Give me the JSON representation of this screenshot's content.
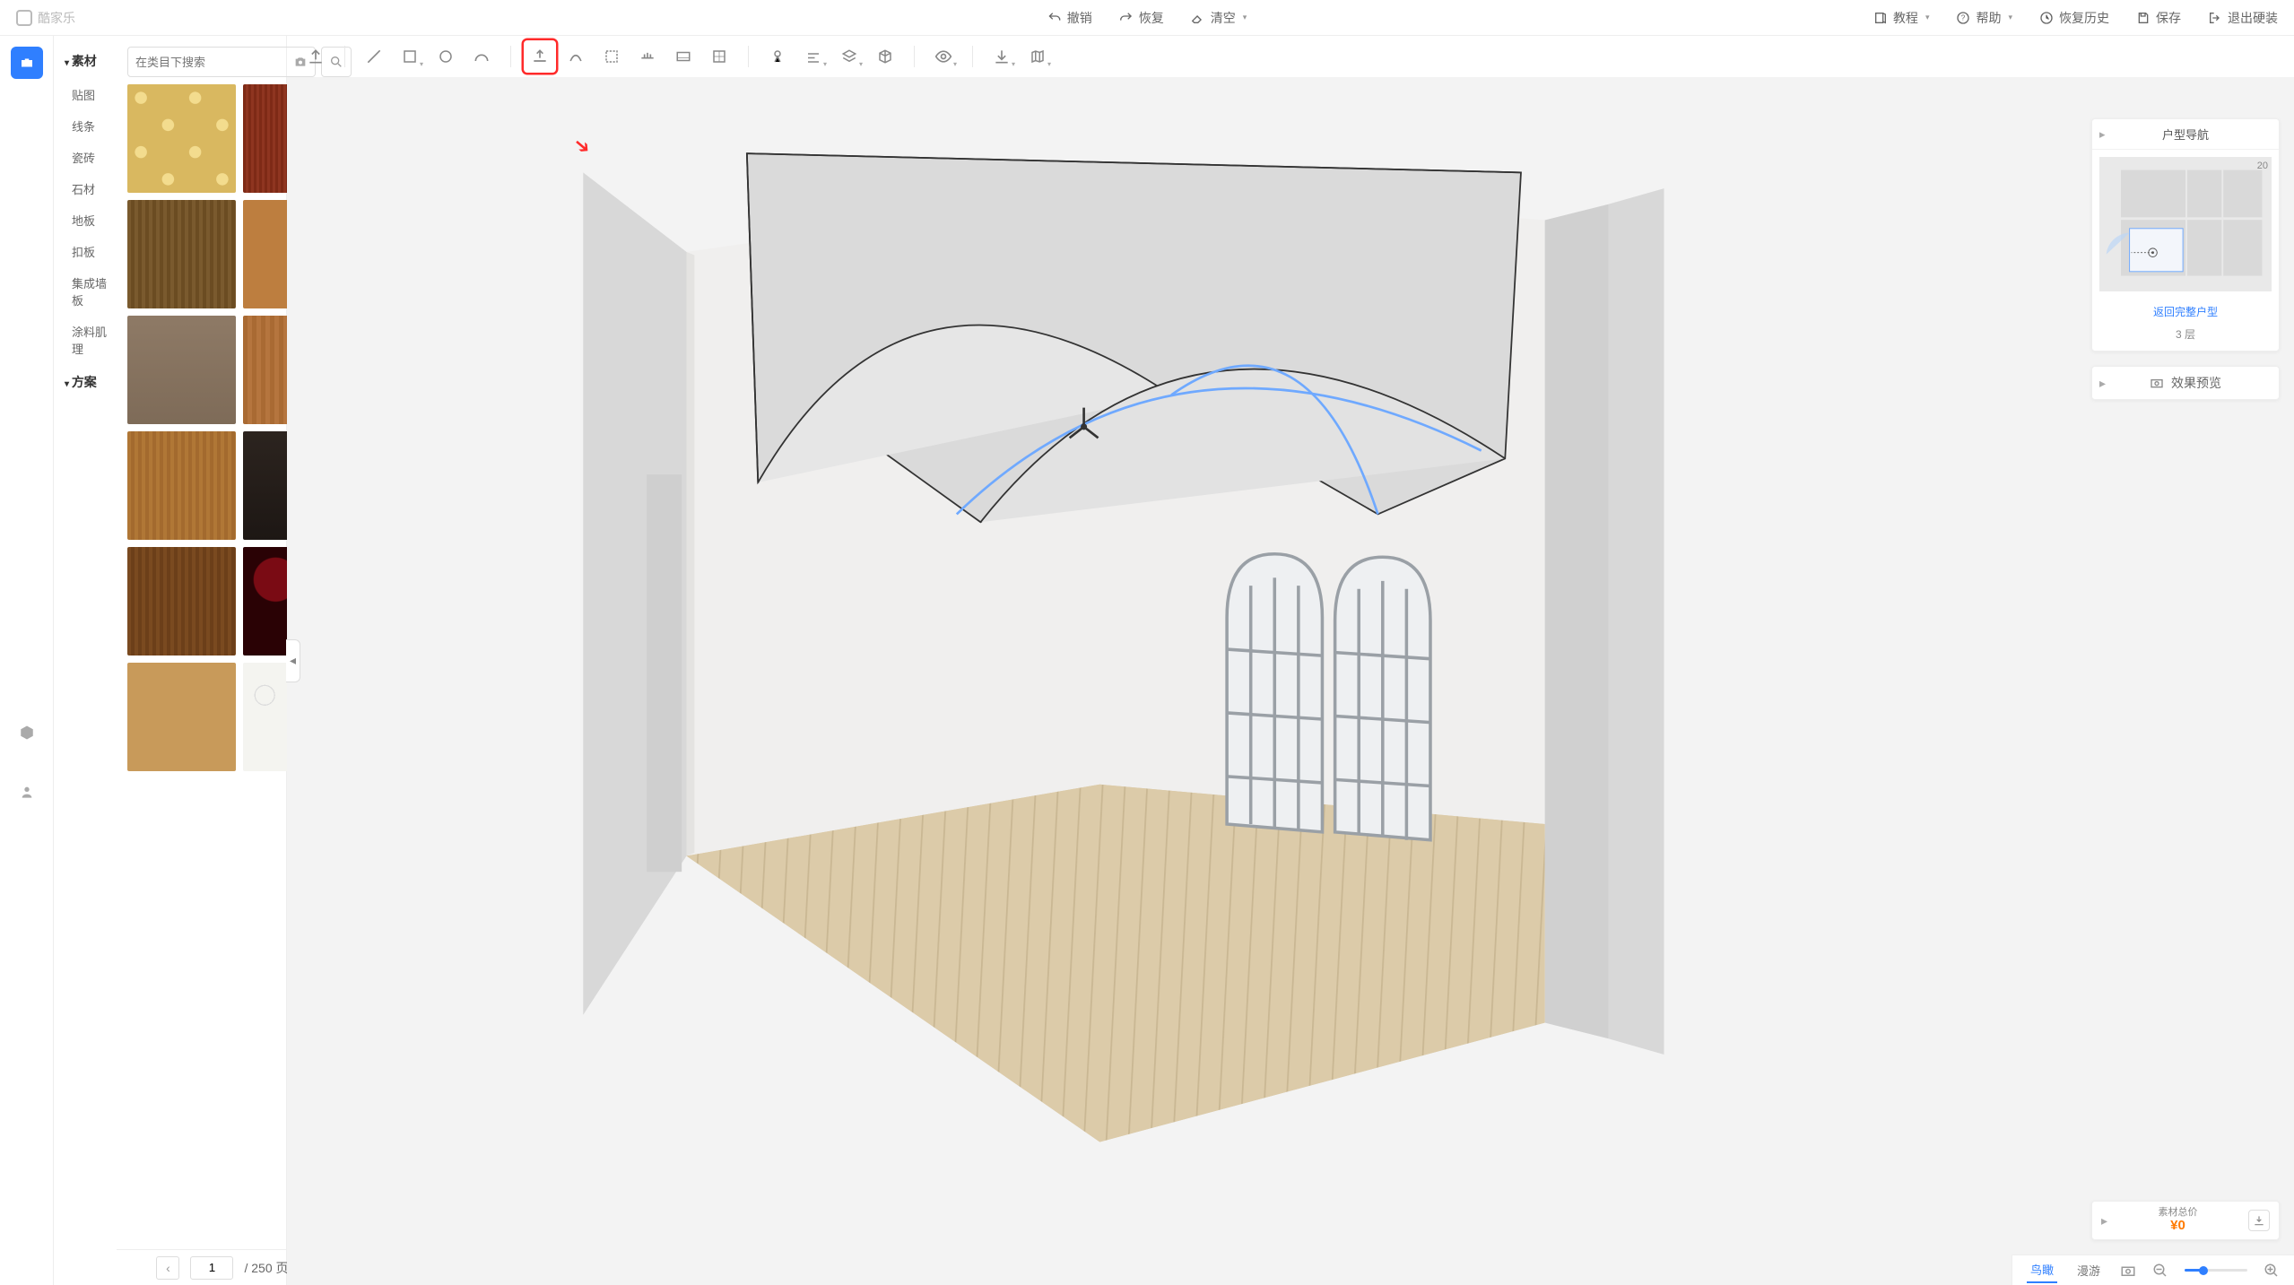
{
  "brand": "酷家乐",
  "top": {
    "undo": "撤销",
    "redo": "恢复",
    "clear": "清空",
    "tutorial": "教程",
    "help": "帮助",
    "history": "恢复历史",
    "save": "保存",
    "exit": "退出硬装"
  },
  "sidebar": {
    "materials_hdr": "素材",
    "items": [
      "贴图",
      "线条",
      "瓷砖",
      "石材",
      "地板",
      "扣板",
      "集成墙板",
      "涂料肌理"
    ],
    "scheme_hdr": "方案"
  },
  "search": {
    "placeholder": "在类目下搜索"
  },
  "pager": {
    "current": "1",
    "total": "/ 250 页"
  },
  "nav_panel": {
    "title": "户型导航",
    "scale": "20",
    "return_link": "返回完整户型",
    "floor": "3 层"
  },
  "preview_panel": {
    "title": "效果预览"
  },
  "price_panel": {
    "label": "素材总价",
    "value": "¥0"
  },
  "footer": {
    "birdview": "鸟瞰",
    "roam": "漫游"
  }
}
